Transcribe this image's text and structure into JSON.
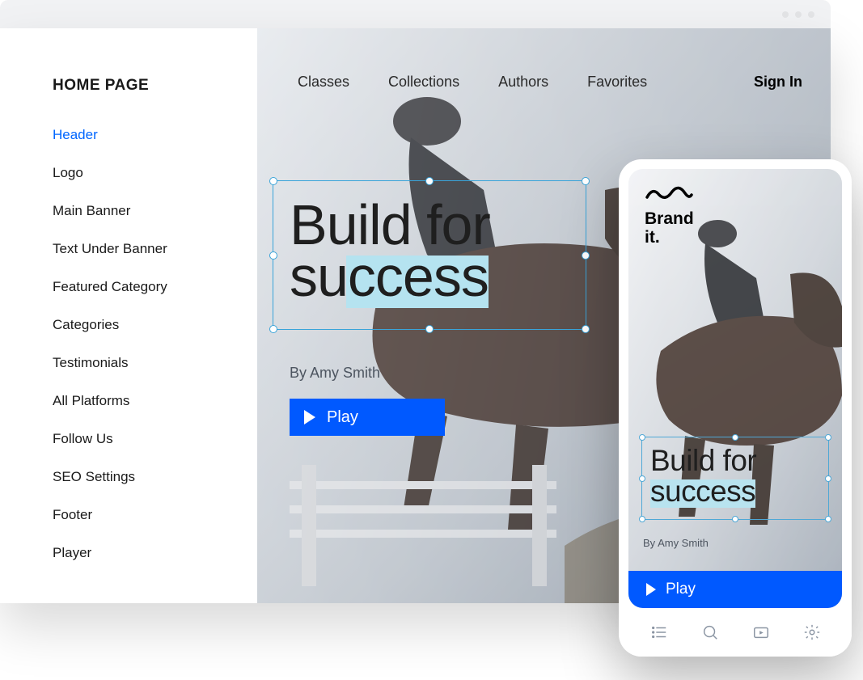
{
  "sidebar": {
    "title": "HOME PAGE",
    "items": [
      {
        "label": "Header",
        "active": true
      },
      {
        "label": "Logo"
      },
      {
        "label": "Main Banner"
      },
      {
        "label": "Text Under Banner"
      },
      {
        "label": "Featured Category"
      },
      {
        "label": "Categories"
      },
      {
        "label": "Testimonials"
      },
      {
        "label": "All Platforms"
      },
      {
        "label": "Follow Us"
      },
      {
        "label": "SEO Settings"
      },
      {
        "label": "Footer"
      },
      {
        "label": "Player"
      }
    ]
  },
  "nav": {
    "items": [
      "Classes",
      "Collections",
      "Authors",
      "Favorites"
    ],
    "sign_in": "Sign In"
  },
  "hero": {
    "line1": "Build for",
    "line2": "success",
    "byline": "By Amy Smith",
    "play_label": "Play"
  },
  "mobile": {
    "brand_line1": "Brand",
    "brand_line2": "it.",
    "hero_line1": "Build for",
    "hero_line2": "success",
    "byline": "By Amy Smith",
    "play_label": "Play"
  }
}
